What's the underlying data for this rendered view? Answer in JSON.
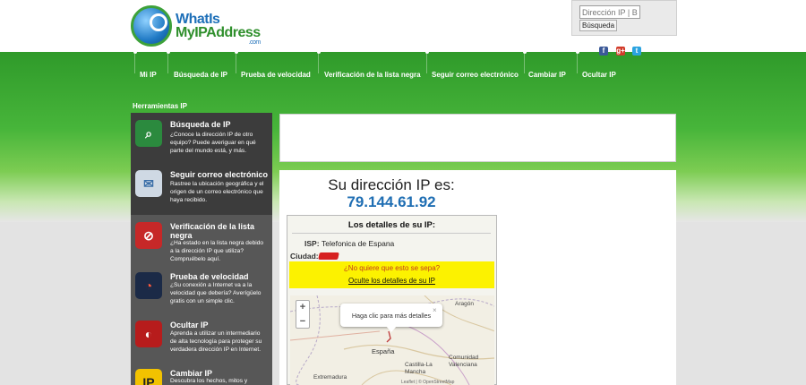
{
  "header": {
    "logo_line1": "WhatIs",
    "logo_line2": "MyIPAddress",
    "logo_dotcom": ".com",
    "search_placeholder": "Dirección IP | Bú",
    "search_button": "Búsqueda",
    "social": {
      "facebook": "f",
      "google": "g+",
      "twitter": "t"
    }
  },
  "nav": {
    "items": [
      "Mi IP",
      "Búsqueda de IP",
      "Prueba de velocidad",
      "Verificación de la lista negra",
      "Seguir correo electrónico",
      "Cambiar IP",
      "Ocultar IP"
    ],
    "subnav": "Herramientas IP"
  },
  "sidebar": {
    "items": [
      {
        "title": "Búsqueda de IP",
        "desc": "¿Conoce la dirección IP de otro equipo? Puede averiguar en qué parte del mundo está, y más.",
        "icon": "magnifier-icon"
      },
      {
        "title": "Seguir correo electrónico",
        "desc": "Rastree la ubicación geográfica y el origen de un correo electrónico que haya recibido.",
        "icon": "map-icon"
      },
      {
        "title": "Verificación de la lista negra",
        "desc": "¿Ha estado en la lista negra debido a la dirección IP que utiliza? Compruébelo aquí.",
        "icon": "blacklist-icon"
      },
      {
        "title": "Prueba de velocidad",
        "desc": "¿Su conexión a Internet va a la velocidad que debería? Averígüelo gratis con un simple clic.",
        "icon": "speedometer-icon"
      },
      {
        "title": "Ocultar IP",
        "desc": "Aprenda a utilizar un intermediario de alta tecnología para proteger su verdadera dirección IP en Internet.",
        "icon": "spy-icon"
      },
      {
        "title": "Cambiar IP",
        "desc": "Descubra los hechos, mitos y",
        "icon": "change-ip-icon"
      }
    ]
  },
  "main": {
    "heading": "Su dirección IP es:",
    "ip": "79.144.61.92",
    "details": {
      "title": "Los detalles de su IP:",
      "isp_label": "ISP:",
      "isp_value": "Telefonica de Espana",
      "city_label": "Ciudad:",
      "question": "¿No quiere que esto se sepa?",
      "hide_link": "Oculte los detalles de su IP"
    },
    "map": {
      "popup": "Haga clic para más detalles",
      "zoom_in": "+",
      "zoom_out": "−",
      "close": "×",
      "labels": [
        "Aragón",
        "España",
        "Castilla-La Mancha",
        "Comunidad Valenciana",
        "Extremadura"
      ],
      "attribution": "Leaflet | © OpenStreetMap"
    }
  },
  "colors": {
    "green_dark": "#2f9a2a",
    "ip_blue": "#1f6eb3",
    "highlight_yellow": "#fcf200",
    "question_red": "#c33b1f",
    "sidebar_gray": "#575757"
  }
}
